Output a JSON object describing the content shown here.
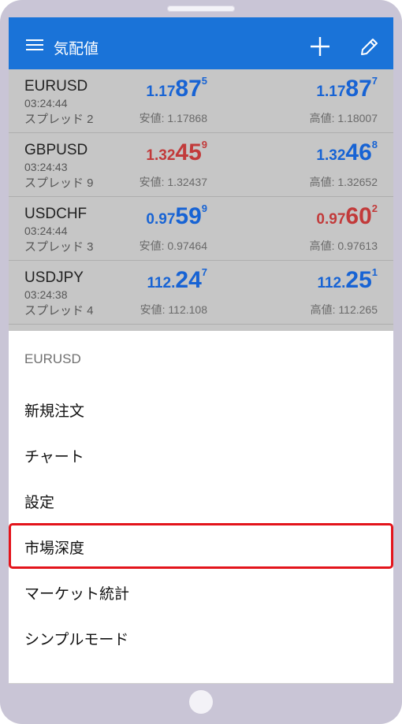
{
  "appbar": {
    "title": "気配値"
  },
  "quotes": [
    {
      "symbol": "EURUSD",
      "time": "03:24:44",
      "spread": "スプレッド 2",
      "bid": {
        "small": "1.17",
        "big": "87",
        "sup": "5",
        "color": "#1763d4"
      },
      "ask": {
        "small": "1.17",
        "big": "87",
        "sup": "7",
        "color": "#1763d4"
      },
      "low": "安値: 1.17868",
      "high": "高値: 1.18007"
    },
    {
      "symbol": "GBPUSD",
      "time": "03:24:43",
      "spread": "スプレッド 9",
      "bid": {
        "small": "1.32",
        "big": "45",
        "sup": "9",
        "color": "#c23a3a"
      },
      "ask": {
        "small": "1.32",
        "big": "46",
        "sup": "8",
        "color": "#1763d4"
      },
      "low": "安値: 1.32437",
      "high": "高値: 1.32652"
    },
    {
      "symbol": "USDCHF",
      "time": "03:24:44",
      "spread": "スプレッド 3",
      "bid": {
        "small": "0.97",
        "big": "59",
        "sup": "9",
        "color": "#1763d4"
      },
      "ask": {
        "small": "0.97",
        "big": "60",
        "sup": "2",
        "color": "#c23a3a"
      },
      "low": "安値: 0.97464",
      "high": "高値: 0.97613"
    },
    {
      "symbol": "USDJPY",
      "time": "03:24:38",
      "spread": "スプレッド 4",
      "bid": {
        "small": "112.",
        "big": "24",
        "sup": "7",
        "color": "#1763d4"
      },
      "ask": {
        "small": "112.",
        "big": "25",
        "sup": "1",
        "color": "#1763d4"
      },
      "low": "安値: 112.108",
      "high": "高値: 112.265"
    }
  ],
  "sheet": {
    "title": "EURUSD",
    "items": [
      "新規注文",
      "チャート",
      "設定",
      "市場深度",
      "マーケット統計",
      "シンプルモード"
    ],
    "highlighted_item": "市場深度"
  },
  "colors": {
    "appbar": "#1a73d8",
    "up": "#1763d4",
    "down": "#c23a3a",
    "highlight": "#e3141b"
  }
}
